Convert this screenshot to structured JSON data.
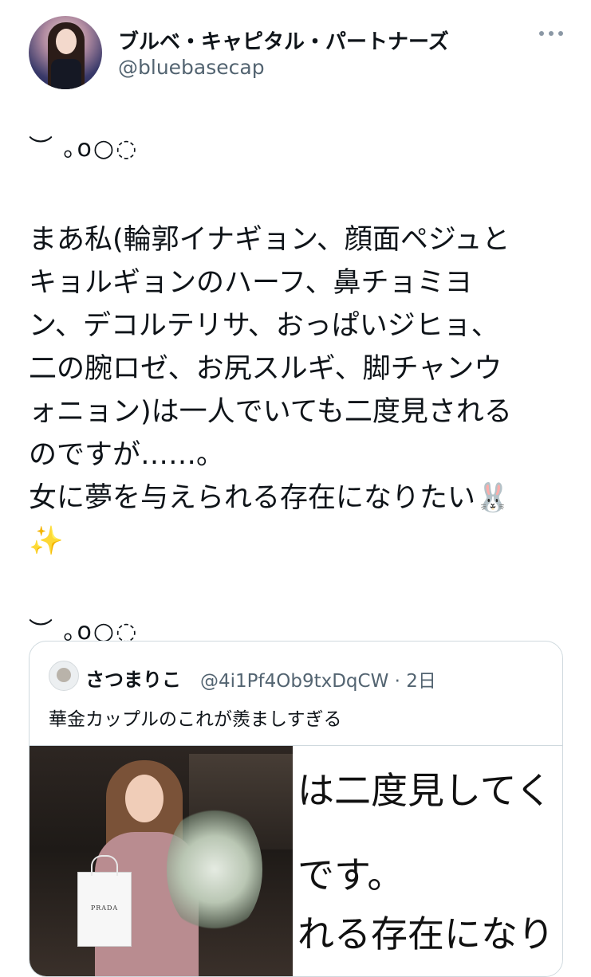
{
  "author": {
    "display_name": "ブルベ・キャピタル・パートナーズ",
    "handle": "@bluebasecap"
  },
  "tweet": {
    "deco_line_1": "︶ ｡o○◌",
    "body": "まあ私(輪郭イナギョン、顔面ペジュと\nキョルギョンのハーフ、鼻チョミヨ\nン、デコルテリサ、おっぱいジヒョ、\n二の腕ロゼ、お尻スルギ、脚チャンウ\nォニョン)は一人でいても二度見される\nのですが……。\n女に夢を与えられる存在になりたい🐰\n✨",
    "deco_line_2": "︶ ｡o○◌"
  },
  "quote": {
    "name": "さつまりこ",
    "handle_and_time": "@4i1Pf4Ob9txDqCW · 2日",
    "text": "華金カップルのこれが羨ましすぎる",
    "photo_bag_label": "PRADA",
    "text_image_lines": [
      "は二度見してく",
      "です。",
      "れる存在になり"
    ]
  },
  "icons": {
    "more": "more-horizontal-icon"
  }
}
